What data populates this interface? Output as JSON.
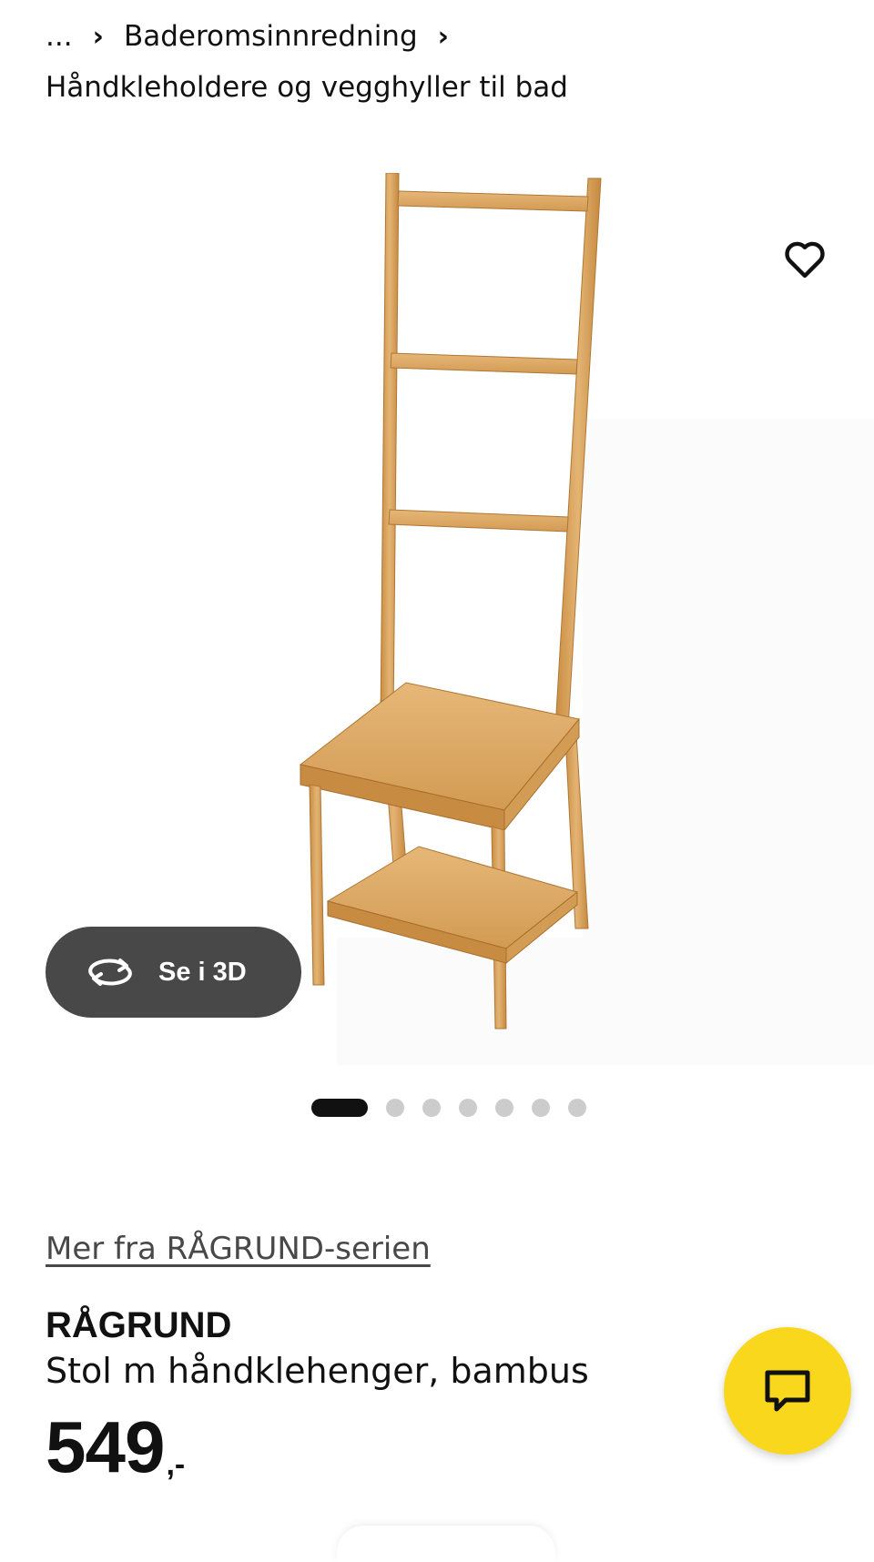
{
  "breadcrumb": {
    "ellipsis": "...",
    "separator": "›",
    "level_1": "Baderomsinnredning",
    "level_2": "Håndkleholdere og vegghyller til bad"
  },
  "gallery": {
    "view_3d_label": "Se i 3D",
    "image_count": 7,
    "active_index": 0,
    "favourite_icon": "heart-outline-icon",
    "rotate_icon": "rotate-3d-icon"
  },
  "product": {
    "series_link": "Mer fra RÅGRUND-serien",
    "name": "RÅGRUND",
    "description": "Stol m håndklehenger, bambus",
    "price_integer": "549",
    "price_suffix": ",-"
  },
  "chat": {
    "icon": "chat-bubble-icon"
  },
  "colors": {
    "accent_yellow": "#f8d71d",
    "button_dark": "#484848",
    "text": "#111111",
    "dot_inactive": "#cccccc",
    "wood_light": "#e2b170",
    "wood_dark": "#b97e34"
  }
}
